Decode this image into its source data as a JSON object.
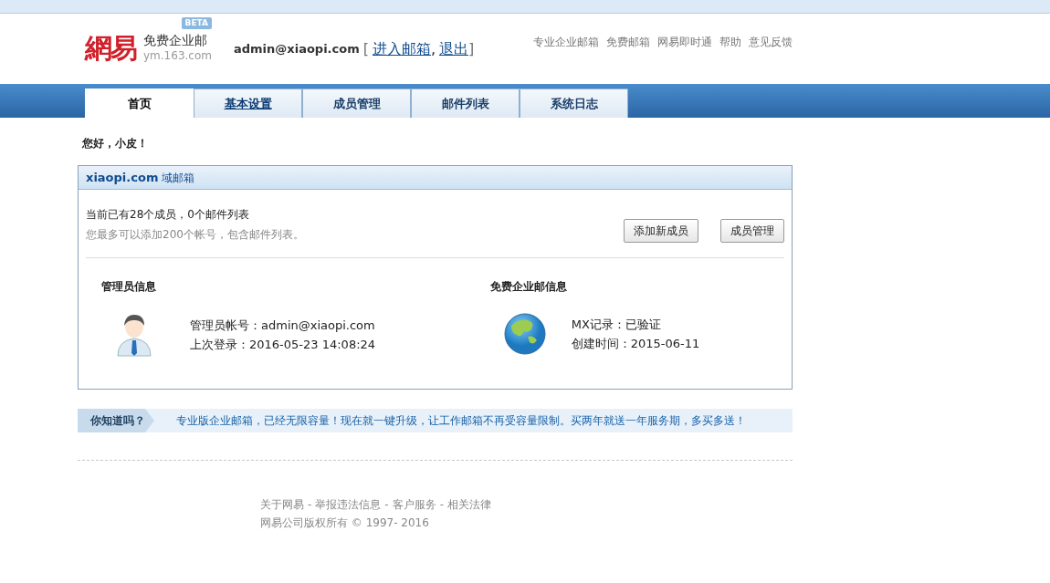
{
  "header": {
    "logo_text": "網易",
    "product": "免费企业邮",
    "badge": "BETA",
    "domain": "ym.163.com",
    "account": "admin@xiaopi.com",
    "bracket_open": "[",
    "account_links": [
      "进入邮箱",
      "退出"
    ],
    "link_separator": ",",
    "bracket_close": "]",
    "nav_links": [
      "专业企业邮箱",
      "免费邮箱",
      "网易即时通",
      "帮助",
      "意见反馈"
    ]
  },
  "tabs": [
    {
      "label": "首页",
      "selected": true,
      "hovered": false
    },
    {
      "label": "基本设置",
      "selected": false,
      "hovered": true
    },
    {
      "label": "成员管理",
      "selected": false,
      "hovered": false
    },
    {
      "label": "邮件列表",
      "selected": false,
      "hovered": false
    },
    {
      "label": "系统日志",
      "selected": false,
      "hovered": false
    }
  ],
  "greeting": "您好，小皮！",
  "panel": {
    "domain": "xiaopi.com",
    "title_suffix": "域邮箱",
    "summary": "当前已有28个成员，0个邮件列表",
    "hint": "您最多可以添加200个帐号，包含邮件列表。",
    "buttons": [
      "添加新成员",
      "成员管理"
    ],
    "sections": [
      {
        "kind": "admin",
        "title": "管理员信息",
        "lines": [
          "管理员帐号：admin@xiaopi.com",
          "上次登录：2016-05-23 14:08:24"
        ]
      },
      {
        "kind": "service",
        "title": "免费企业邮信息",
        "lines": [
          "MX记录：已验证",
          "创建时间：2015-06-11"
        ]
      }
    ]
  },
  "tip": {
    "label": "你知道吗？",
    "text": "专业版企业邮箱，已经无限容量！现在就一键升级，让工作邮箱不再受容量限制。买两年就送一年服务期，多买多送！"
  },
  "footer": {
    "links": [
      "关于网易",
      "举报违法信息",
      "客户服务",
      "相关法律"
    ],
    "separator": "-",
    "copyright": "网易公司版权所有 © 1997- 2016"
  }
}
